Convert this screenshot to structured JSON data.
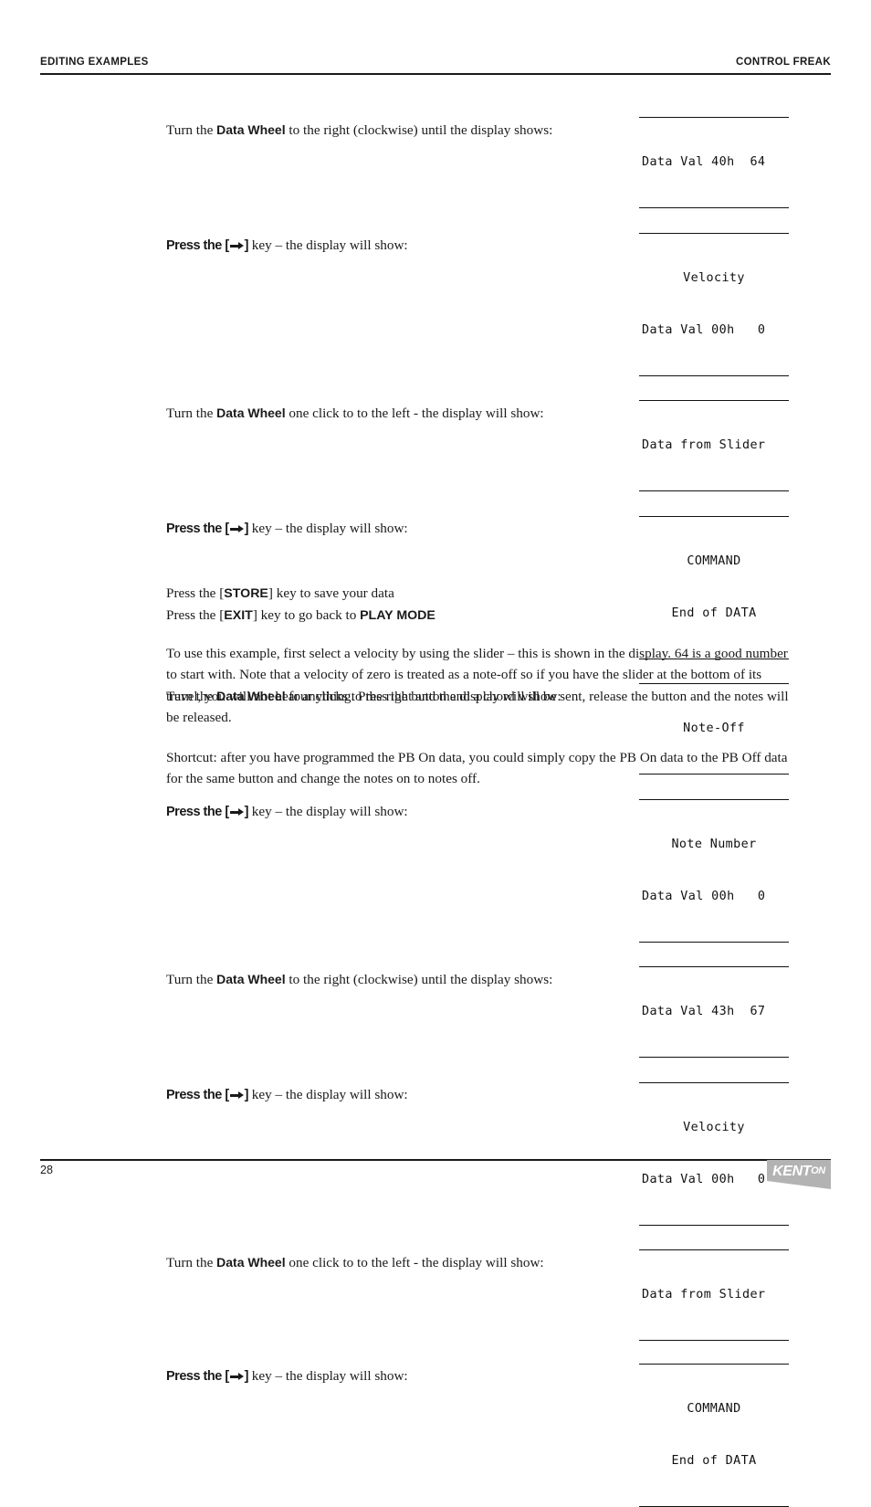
{
  "header": {
    "left": "EDITING EXAMPLES",
    "right": "CONTROL FREAK"
  },
  "steps": [
    {
      "text_before": "Turn the ",
      "bold": "Data Wheel",
      "text_after": " to the right (clockwise) until the display shows:",
      "display": {
        "lines": [
          "Data Val 40h  64"
        ],
        "align": "mono"
      }
    },
    {
      "text_before": "Press the [",
      "bold": "→",
      "text_after": "] key – the display will show:",
      "display": {
        "lines": [
          "Velocity",
          "Data Val 00h   0"
        ],
        "align": "mixed"
      }
    },
    {
      "text_before": "Turn the ",
      "bold": "Data Wheel",
      "text_after": " one click to to the left - the display will show:",
      "display": {
        "lines": [
          "Data from Slider"
        ],
        "align": "mono"
      }
    },
    {
      "text_before": "Press the [",
      "bold": "→",
      "text_after": "] key – the display will show:",
      "display": {
        "lines": [
          "COMMAND",
          "End of DATA"
        ],
        "align": "center"
      }
    },
    {
      "text_before": "Turn the ",
      "bold": "Data Wheel",
      "text_after": " four clicks to the right and the display will show:",
      "display": {
        "lines": [
          "Note-Off"
        ],
        "align": "center"
      }
    },
    {
      "text_before": "Press the [",
      "bold": "→",
      "text_after": "] key – the display will show:",
      "display": {
        "lines": [
          "Note Number",
          "Data Val 00h   0"
        ],
        "align": "mixed"
      }
    },
    {
      "text_before": "Turn the ",
      "bold": "Data Wheel",
      "text_after": " to the right (clockwise) until the display shows:",
      "display": {
        "lines": [
          "Data Val 43h  67"
        ],
        "align": "mono"
      }
    },
    {
      "text_before": "Press the [",
      "bold": "→",
      "text_after": "] key – the display will show:",
      "display": {
        "lines": [
          "Velocity",
          "Data Val 00h   0"
        ],
        "align": "mixed"
      }
    },
    {
      "text_before": "Turn the ",
      "bold": "Data Wheel",
      "text_after": " one click to to the left - the display will show:",
      "display": {
        "lines": [
          "Data from Slider"
        ],
        "align": "mono"
      }
    },
    {
      "text_before": "Press the [",
      "bold": "→",
      "text_after": "] key – the display will show:",
      "display": {
        "lines": [
          "COMMAND",
          "End of DATA"
        ],
        "align": "center"
      }
    }
  ],
  "display_values": {
    "data_val_40h": "Data Val 40h  64",
    "velocity_label": "Velocity",
    "data_val_00h": "Data Val 00h   0",
    "data_from_slider": "Data from Slider",
    "command_label": "COMMAND",
    "end_of_data": "End of DATA",
    "note_off": "Note-Off",
    "note_number_label": "Note Number",
    "data_val_43h": "Data Val 43h  67"
  },
  "store_exit": {
    "line1_pre": "Press the [",
    "line1_key": "STORE",
    "line1_post": "] key to save your data",
    "line2_pre": "Press the [",
    "line2_key": "EXIT",
    "line2_mid": "] key to go back to ",
    "line2_bold": "PLAY MODE"
  },
  "paragraphs": {
    "p1": "To use this example, first select a velocity by using the slider – this is shown in the display. 64 is a good number to start with. Note that a velocity of zero is treated as a note-off so if you have the slider at the bottom of its travel, you will not hear anything. Press the button and a chord will be sent, release the button and the notes will be released.",
    "p2": "Shortcut: after you have programmed the PB On data, you could simply copy the PB On data to the PB Off data for the same button and change the notes on to notes off."
  },
  "footer": {
    "page_number": "28",
    "logo_primary": "KENT",
    "logo_secondary": "ON"
  }
}
